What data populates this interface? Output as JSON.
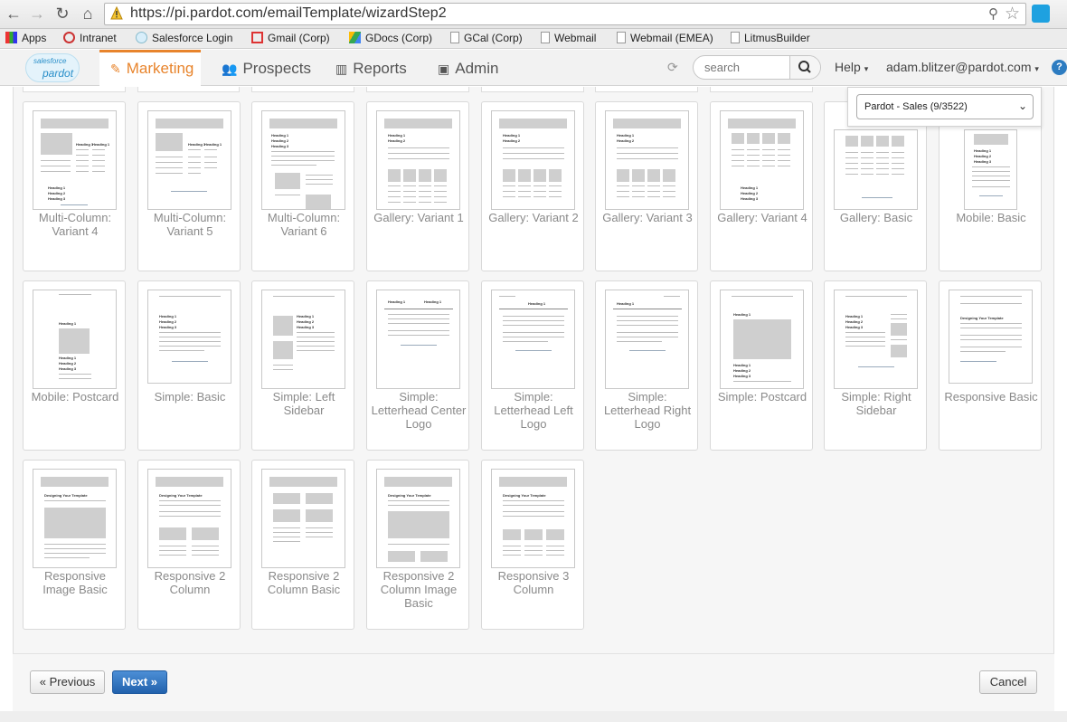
{
  "browser": {
    "url": "https://pi.pardot.com/emailTemplate/wizardStep2",
    "bookmarks": [
      "Apps",
      "Intranet",
      "Salesforce Login",
      "Gmail (Corp)",
      "GDocs (Corp)",
      "GCal (Corp)",
      "Webmail",
      "Webmail (EMEA)",
      "LitmusBuilder"
    ]
  },
  "nav": {
    "logo_top": "salesforce",
    "logo_bottom": "pardot",
    "tabs": [
      "Marketing",
      "Prospects",
      "Reports",
      "Admin"
    ],
    "active_tab": "Marketing",
    "search_placeholder": "search",
    "help": "Help",
    "user": "adam.blitzer@pardot.com",
    "account_selector": "Pardot - Sales (9/3522)"
  },
  "templates": [
    [
      "Multi-Column: Variant 4",
      "Multi-Column: Variant 5",
      "Multi-Column: Variant 6",
      "Gallery: Variant 1",
      "Gallery: Variant 2",
      "Gallery: Variant 3",
      "Gallery: Variant 4",
      "Gallery: Basic",
      "Mobile: Basic"
    ],
    [
      "Mobile: Postcard",
      "Simple: Basic",
      "Simple: Left Sidebar",
      "Simple: Letterhead Center Logo",
      "Simple: Letterhead Left Logo",
      "Simple: Letterhead Right Logo",
      "Simple: Postcard",
      "Simple: Right Sidebar",
      "Responsive Basic"
    ],
    [
      "Responsive Image Basic",
      "Responsive 2 Column",
      "Responsive 2 Column Basic",
      "Responsive 2 Column Image Basic",
      "Responsive 3 Column"
    ]
  ],
  "thumb_text": {
    "h1": "Heading 1",
    "h2": "Heading 2",
    "h3": "Heading 3",
    "designing": "Designing Your Template"
  },
  "actions": {
    "previous": "« Previous",
    "next": "Next »",
    "cancel": "Cancel"
  }
}
